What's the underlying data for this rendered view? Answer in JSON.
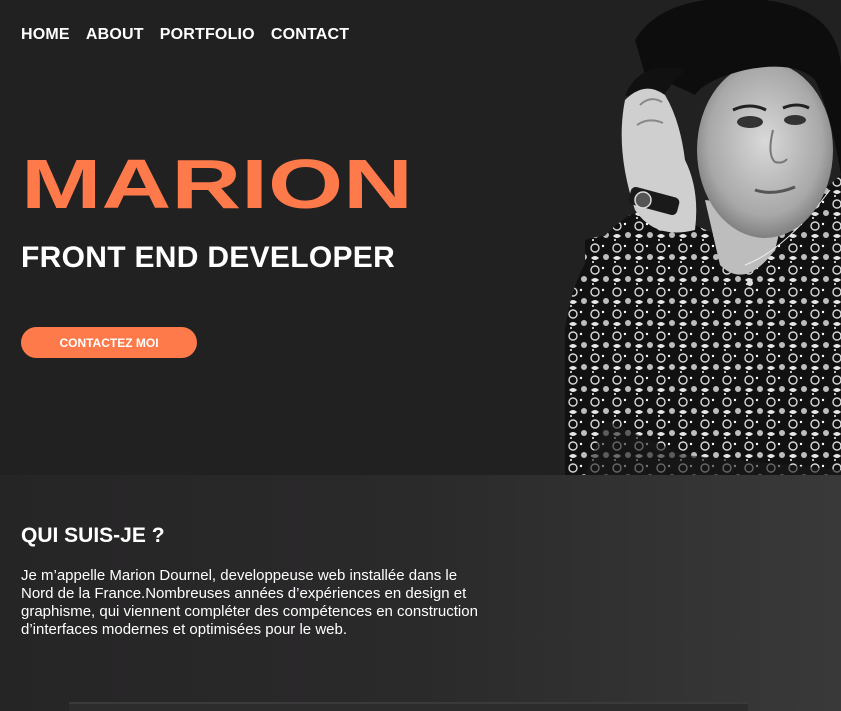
{
  "nav": {
    "items": [
      "HOME",
      "ABOUT",
      "PORTFOLIO",
      "CONTACT"
    ]
  },
  "hero": {
    "name": "MARION",
    "subtitle": "FRONT END DEVELOPER",
    "cta_label": "CONTACTEZ MOI",
    "portrait_icon": "person-portrait-icon"
  },
  "about": {
    "heading": "QUI SUIS-JE ?",
    "text": "Je m’appelle Marion Dournel, developpeuse web installée dans le Nord de la France.Nombreuses années d’expériences en design et graphisme, qui viennent compléter des compétences en construction d’interfaces modernes et optimisées pour le web."
  },
  "colors": {
    "accent": "#ff7a4a",
    "background": "#222122",
    "text": "#ffffff"
  }
}
